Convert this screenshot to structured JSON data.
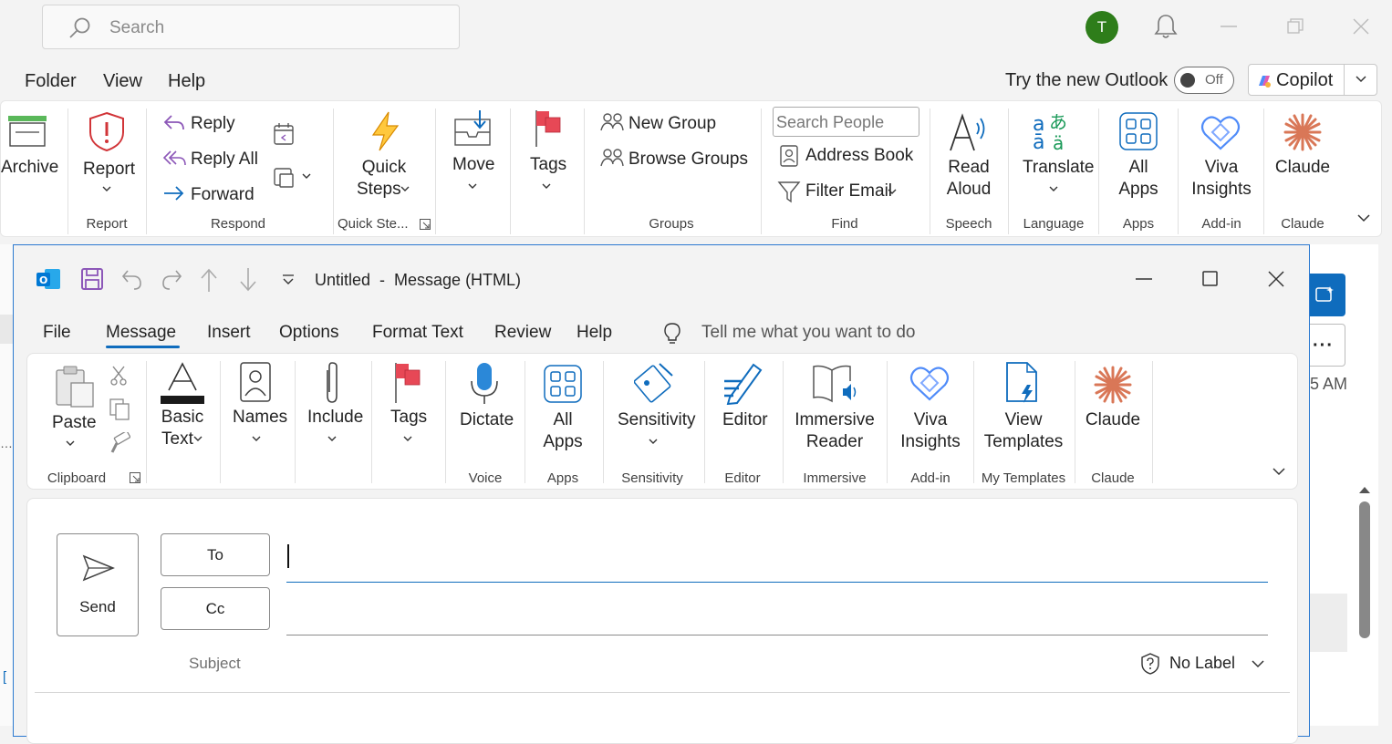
{
  "main": {
    "search_placeholder": "Search",
    "avatar_initial": "T",
    "menu": [
      "Folder",
      "View",
      "Help"
    ],
    "try_new_outlook": "Try the new Outlook",
    "toggle_state": "Off",
    "copilot_label": "Copilot",
    "ribbon": {
      "archive": "Archive",
      "report": "Report",
      "reply": "Reply",
      "reply_all": "Reply All",
      "forward": "Forward",
      "quick_steps": [
        "Quick",
        "Steps"
      ],
      "move": "Move",
      "tags": "Tags",
      "new_group": "New Group",
      "browse_groups": "Browse Groups",
      "search_people_placeholder": "Search People",
      "address_book": "Address Book",
      "filter_email": "Filter Email",
      "read_aloud": [
        "Read",
        "Aloud"
      ],
      "translate": "Translate",
      "all_apps": [
        "All",
        "Apps"
      ],
      "viva_insights": [
        "Viva",
        "Insights"
      ],
      "claude": "Claude",
      "groups": {
        "report": "Report",
        "respond": "Respond",
        "quick_steps": "Quick Ste...",
        "groups": "Groups",
        "find": "Find",
        "speech": "Speech",
        "language": "Language",
        "apps": "Apps",
        "addin": "Add-in",
        "claude": "Claude"
      }
    },
    "side_time": "5 AM"
  },
  "compose": {
    "title": "Untitled  -  Message (HTML)",
    "tabs": [
      "File",
      "Message",
      "Insert",
      "Options",
      "Format Text",
      "Review",
      "Help"
    ],
    "active_tab": "Message",
    "tell_me": "Tell me what you want to do",
    "ribbon": {
      "paste": "Paste",
      "basic_text": [
        "Basic",
        "Text"
      ],
      "names": "Names",
      "include": "Include",
      "tags": "Tags",
      "dictate": "Dictate",
      "all_apps": [
        "All",
        "Apps"
      ],
      "sensitivity": "Sensitivity",
      "editor": "Editor",
      "immersive_reader": [
        "Immersive",
        "Reader"
      ],
      "viva_insights": [
        "Viva",
        "Insights"
      ],
      "view_templates": [
        "View",
        "Templates"
      ],
      "claude": "Claude",
      "groups": {
        "clipboard": "Clipboard",
        "voice": "Voice",
        "apps": "Apps",
        "sensitivity": "Sensitivity",
        "editor": "Editor",
        "immersive": "Immersive",
        "addin": "Add-in",
        "my_templates": "My Templates",
        "claude": "Claude"
      }
    },
    "send": "Send",
    "to": "To",
    "cc": "Cc",
    "subject": "Subject",
    "label": "No Label"
  },
  "colors": {
    "accent": "#0f6cbd",
    "avatar": "#2e7d1a",
    "compose_border": "#2b79d0",
    "claude": "#d97757"
  }
}
